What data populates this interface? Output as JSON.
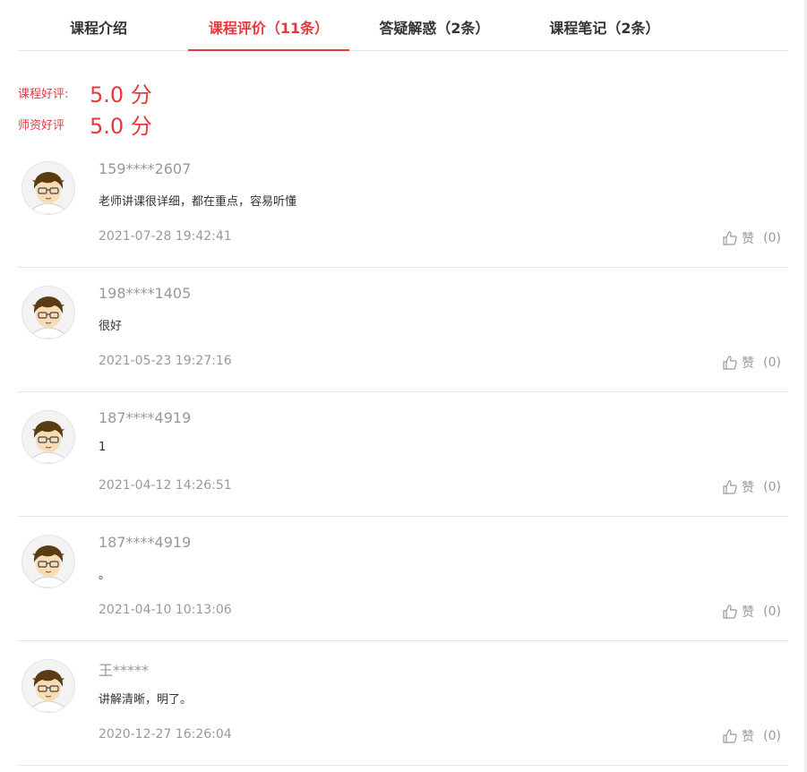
{
  "tabs": [
    {
      "label": "课程介绍",
      "active": false
    },
    {
      "label": "课程评价（11条）",
      "active": true
    },
    {
      "label": "答疑解惑（2条）",
      "active": false
    },
    {
      "label": "课程笔记（2条）",
      "active": false
    }
  ],
  "ratings": {
    "course": {
      "label": "课程好评:",
      "value": "5.0 分"
    },
    "teacher": {
      "label": "师资好评",
      "value": "5.0 分"
    }
  },
  "like_label": "赞",
  "reviews": [
    {
      "user": "159****2607",
      "content": "老师讲课很详细，都在重点，容易听懂",
      "date": "2021-07-28 19:42:41",
      "likes": "(0)"
    },
    {
      "user": "198****1405",
      "content": "很好",
      "date": "2021-05-23 19:27:16",
      "likes": "(0)"
    },
    {
      "user": "187****4919",
      "content": "1",
      "date": "2021-04-12 14:26:51",
      "likes": "(0)"
    },
    {
      "user": "187****4919",
      "content": "。",
      "date": "2021-04-10 10:13:06",
      "likes": "(0)"
    },
    {
      "user": "王*****",
      "content": "讲解清晰，明了。",
      "date": "2020-12-27 16:26:04",
      "likes": "(0)"
    }
  ],
  "colors": {
    "accent": "#e8383d",
    "muted": "#999999",
    "divider": "#e5e5e5"
  },
  "icons": {
    "avatar": "avatar-icon",
    "like": "thumbs-up-icon"
  }
}
